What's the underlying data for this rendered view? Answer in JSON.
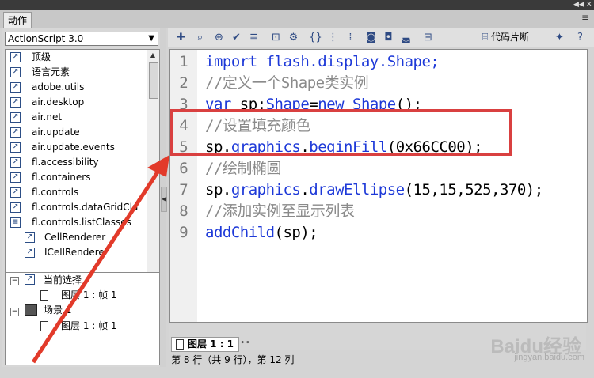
{
  "panel_tab": "动作",
  "panel_menu_icon": "≡",
  "language_select": "ActionScript 3.0",
  "library_items": [
    {
      "label": "顶级",
      "icon": "book",
      "indent": 0
    },
    {
      "label": "语言元素",
      "icon": "book",
      "indent": 0
    },
    {
      "label": "adobe.utils",
      "icon": "book",
      "indent": 0
    },
    {
      "label": "air.desktop",
      "icon": "book",
      "indent": 0
    },
    {
      "label": "air.net",
      "icon": "book",
      "indent": 0
    },
    {
      "label": "air.update",
      "icon": "book",
      "indent": 0
    },
    {
      "label": "air.update.events",
      "icon": "book",
      "indent": 0
    },
    {
      "label": "fl.accessibility",
      "icon": "book",
      "indent": 0
    },
    {
      "label": "fl.containers",
      "icon": "book",
      "indent": 0
    },
    {
      "label": "fl.controls",
      "icon": "book",
      "indent": 0
    },
    {
      "label": "fl.controls.dataGridCla",
      "icon": "book",
      "indent": 0
    },
    {
      "label": "fl.controls.listClasses",
      "icon": "book-open",
      "indent": 0
    },
    {
      "label": "CellRenderer",
      "icon": "book",
      "indent": 1
    },
    {
      "label": "ICellRenderer",
      "icon": "book",
      "indent": 1
    }
  ],
  "tree": {
    "current_selection": "当前选择",
    "current_frame": "图层 1 : 帧 1",
    "scene": "场景 1",
    "scene_frame": "图层 1 : 帧 1"
  },
  "toolbar": {
    "snippets_label": "代码片断"
  },
  "code_lines": [
    {
      "n": "1",
      "parts": [
        {
          "t": "import flash.display.Shape;",
          "c": "kw"
        }
      ]
    },
    {
      "n": "2",
      "parts": [
        {
          "t": "//定义一个Shape类实例",
          "c": "cm"
        }
      ]
    },
    {
      "n": "3",
      "parts": [
        {
          "t": "var ",
          "c": "kw"
        },
        {
          "t": "sp:",
          "c": ""
        },
        {
          "t": "Shape",
          "c": "kw"
        },
        {
          "t": "=",
          "c": ""
        },
        {
          "t": "new Shape",
          "c": "kw"
        },
        {
          "t": "();",
          "c": ""
        }
      ]
    },
    {
      "n": "4",
      "parts": [
        {
          "t": "//设置填充颜色",
          "c": "cm"
        }
      ]
    },
    {
      "n": "5",
      "parts": [
        {
          "t": "sp.",
          "c": ""
        },
        {
          "t": "graphics",
          "c": "kw"
        },
        {
          "t": ".",
          "c": ""
        },
        {
          "t": "beginFill",
          "c": "kw"
        },
        {
          "t": "(0x66CC00);",
          "c": ""
        }
      ]
    },
    {
      "n": "6",
      "parts": [
        {
          "t": "//绘制椭圆",
          "c": "cm"
        }
      ]
    },
    {
      "n": "7",
      "parts": [
        {
          "t": "sp.",
          "c": ""
        },
        {
          "t": "graphics",
          "c": "kw"
        },
        {
          "t": ".",
          "c": ""
        },
        {
          "t": "drawEllipse",
          "c": "kw"
        },
        {
          "t": "(15,15,525,370);",
          "c": ""
        }
      ]
    },
    {
      "n": "8",
      "parts": [
        {
          "t": "//添加实例至显示列表",
          "c": "cm"
        }
      ]
    },
    {
      "n": "9",
      "parts": [
        {
          "t": "addChild",
          "c": "kw"
        },
        {
          "t": "(sp);",
          "c": ""
        }
      ]
    }
  ],
  "frame_tab": "图层 1 : 1",
  "status_text": "第 8 行（共 9 行），第 12 列",
  "watermark": "Baidu经验",
  "watermark_sub": "jingyan.baidu.com",
  "colors": {
    "keyword": "#1d39d8",
    "comment": "#8a8a8a",
    "highlight_box": "#d94040",
    "arrow": "#e23a2a"
  }
}
